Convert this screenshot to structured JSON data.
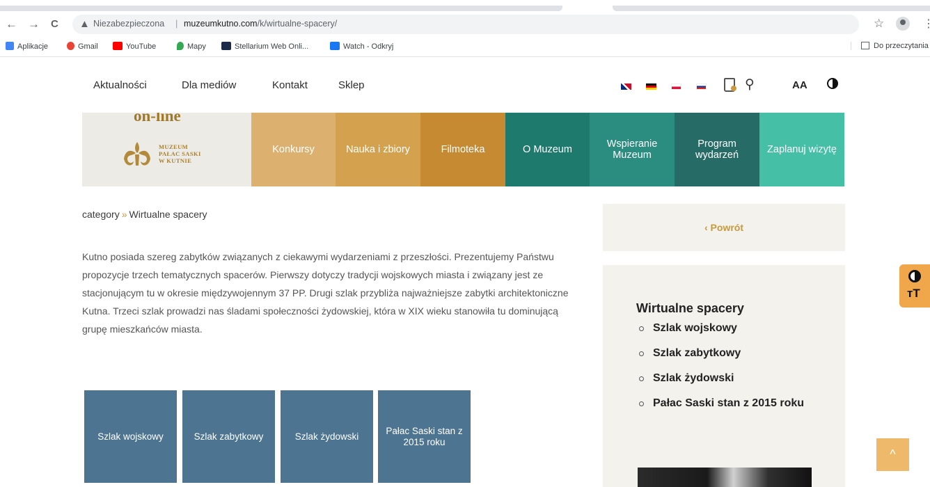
{
  "browser": {
    "back_glyph": "←",
    "forward_glyph": "→",
    "reload_glyph": "C",
    "security_label": "Niezabezpieczona",
    "separator": "|",
    "url_host": "muzeumkutno.com",
    "url_path": "/k/wirtualne-spacery/",
    "bookmarks": [
      {
        "label": "Aplikacje",
        "icon": "apps-grid-icon",
        "color": "#4285f4"
      },
      {
        "label": "Gmail",
        "icon": "google-icon",
        "color": "#ea4335"
      },
      {
        "label": "YouTube",
        "icon": "youtube-icon",
        "color": "#ff0000"
      },
      {
        "label": "Mapy",
        "icon": "maps-pin-icon",
        "color": "#34a853"
      },
      {
        "label": "Stellarium Web Onli...",
        "icon": "stellarium-icon",
        "color": "#1b2a49"
      },
      {
        "label": "Watch - Odkryj",
        "icon": "facebook-icon",
        "color": "#1877f2"
      }
    ],
    "reading_list": "Do przeczytania"
  },
  "site": {
    "top_nav": [
      "Aktualności",
      "Dla mediów",
      "Kontakt",
      "Sklep"
    ],
    "languages": [
      "en-flag",
      "de-flag",
      "pl-flag",
      "ru-flag"
    ],
    "font_size_label": "AA",
    "logo": {
      "online": "on-line",
      "line1": "MUZEUM",
      "line2": "PAŁAC SASKI",
      "line3": "W KUTNIE"
    },
    "menu": [
      {
        "label": "Konkursy",
        "color": "#dcb06e"
      },
      {
        "label": "Nauka i zbiory",
        "color": "#d4a24f"
      },
      {
        "label": "Filmoteka",
        "color": "#c68a33"
      },
      {
        "label": "O Muzeum",
        "color": "#1f7a6e"
      },
      {
        "label": "Wspieranie Muzeum",
        "color": "#2b8d80"
      },
      {
        "label": "Program wydarzeń",
        "color": "#266b66"
      },
      {
        "label": "Zaplanuj wizytę",
        "color": "#45bfa5"
      }
    ]
  },
  "content": {
    "breadcrumb_root": "category",
    "breadcrumb_sep": "»",
    "breadcrumb_current": "Wirtualne spacery",
    "intro": "Kutno posiada szereg zabytków związanych z ciekawymi wydarzeniami z przeszłości. Prezentujemy Państwu propozycje trzech tematycznych spacerów. Pierwszy dotyczy tradycji wojskowych miasta i związany jest ze stacjonującym tu w okresie międzywojennym 37 PP. Drugi szlak przybliża najważniejsze zabytki architektoniczne Kutna. Trzeci szlak prowadzi nas śladami społeczności żydowskiej, która w XIX wieku stanowiła tu dominującą grupę mieszkańców miasta.",
    "tiles": [
      "Szlak wojskowy",
      "Szlak zabytkowy",
      "Szlak żydowski",
      "Pałac Saski stan z 2015 roku"
    ]
  },
  "sidebar": {
    "back_label": "‹ Powrót",
    "title": "Wirtualne spacery",
    "items": [
      "Szlak wojskowy",
      "Szlak zabytkowy",
      "Szlak żydowski",
      "Pałac Saski stan z 2015 roku"
    ]
  },
  "a11y": {
    "text_label": "тT",
    "scroll_top_glyph": "^"
  }
}
